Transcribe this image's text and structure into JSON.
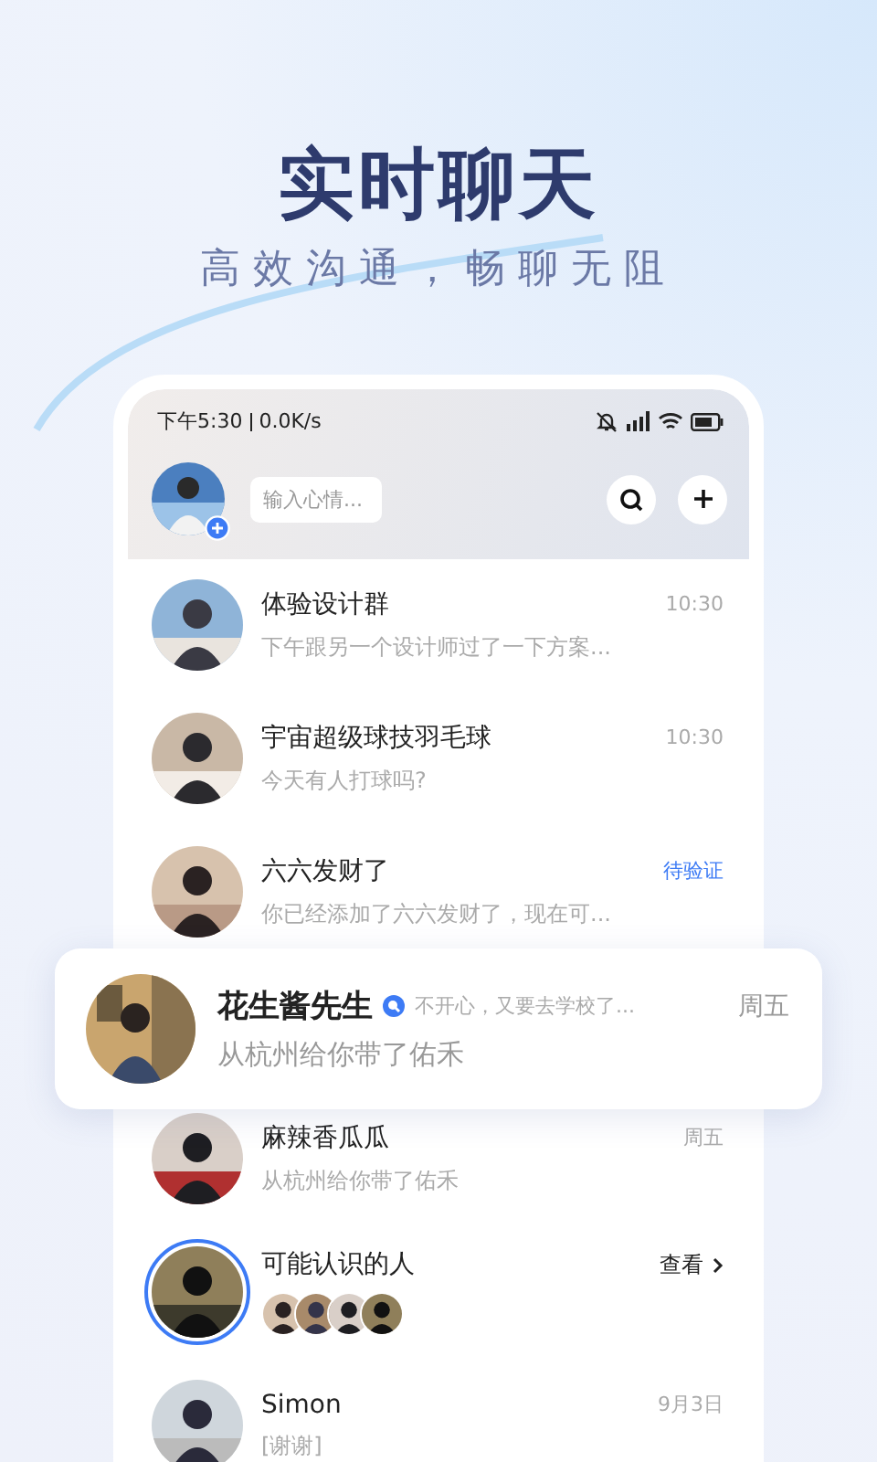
{
  "hero": {
    "title": "实时聊天",
    "subtitle": "高效沟通，畅聊无阻"
  },
  "status_bar": {
    "time": "下午5:30",
    "speed": "0.0K/s"
  },
  "header": {
    "mood_placeholder": "输入心情..."
  },
  "chats": [
    {
      "kind": "chat",
      "name": "体验设计群",
      "message": "下午跟另一个设计师过了一下方案...",
      "time": "10:30"
    },
    {
      "kind": "chat",
      "name": "宇宙超级球技羽毛球",
      "message": "今天有人打球吗?",
      "time": "10:30"
    },
    {
      "kind": "pending",
      "name": "六六发财了",
      "message": "你已经添加了六六发财了，现在可...",
      "time": "待验证"
    },
    {
      "kind": "hidden"
    },
    {
      "kind": "chat",
      "name": "麻辣香瓜瓜",
      "message": "从杭州给你带了佑禾",
      "time": "周五"
    },
    {
      "kind": "suggest",
      "name": "可能认识的人",
      "time": "查看"
    },
    {
      "kind": "chat",
      "name": "Simon",
      "message": "[谢谢]",
      "time": "9月3日"
    }
  ],
  "featured": {
    "name": "花生酱先生",
    "status": "不开心，又要去学校了...",
    "message": "从杭州给你带了佑禾",
    "time": "周五"
  }
}
